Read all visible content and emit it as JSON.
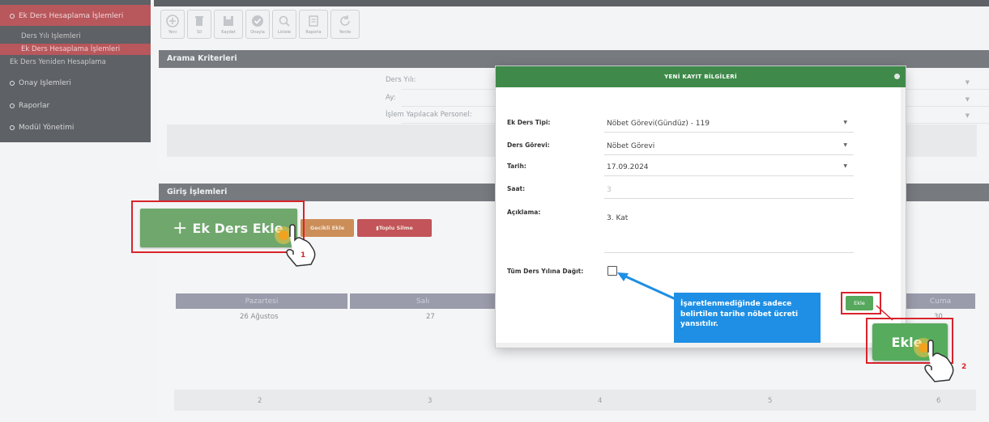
{
  "sidebar": {
    "active_section": "Ek Ders Hesaplama İşlemleri",
    "sub_items": [
      "Ders Yılı İşlemleri",
      "Ek Ders Hesaplama İşlemleri",
      "Ek Ders Yeniden Hesaplama"
    ],
    "sections": [
      "Onay İşlemleri",
      "Raporlar",
      "Modül Yönetimi"
    ]
  },
  "toolbar": {
    "buttons": [
      "Yeni",
      "Sil",
      "Kaydet",
      "Onayla",
      "Listele",
      "Raporla",
      "Yenile"
    ]
  },
  "search_panel": {
    "title": "Arama Kriterleri",
    "labels": [
      "Ders Yılı:",
      "Ay:",
      "İşlem Yapılacak Personel:"
    ]
  },
  "entry_panel": {
    "title": "Giriş İşlemleri",
    "add_button_label": "Ek Ders Ekle",
    "add_button_prefix": "+",
    "bulk_copy_label": "Gecikli Ekle",
    "bulk_delete_label": "Toplu Silme",
    "step1": "1"
  },
  "calendar": {
    "days": [
      "Pazartesi",
      "Salı",
      "Cuma"
    ],
    "dates": [
      "26 Ağustos",
      "27",
      "30"
    ],
    "week_numbers": [
      "2",
      "3",
      "4",
      "5",
      "6"
    ]
  },
  "modal": {
    "title": "YENİ KAYIT BİLGİLERİ",
    "fields": {
      "ek_ders_tipi": {
        "label": "Ek Ders Tipi:",
        "value": "Nöbet Görevi(Gündüz) - 119"
      },
      "ders_gorevi": {
        "label": "Ders Görevi:",
        "value": "Nöbet Görevi"
      },
      "tarih": {
        "label": "Tarih:",
        "value": "17.09.2024"
      },
      "saat": {
        "label": "Saat:",
        "value": "3"
      },
      "aciklama": {
        "label": "Açıklama:",
        "value": "3. Kat"
      },
      "tum_ders_yili": {
        "label": "Tüm Ders Yılına Dağıt:",
        "checked": false
      }
    },
    "submit_label": "Ekle"
  },
  "callout": {
    "text": "İşaretlenmediğinde sadece belirtilen tarihe nöbet ücreti yansıtılır."
  },
  "zoom": {
    "ekle_label": "Ekle",
    "step2": "2"
  },
  "colors": {
    "accent_green": "#57ab5d",
    "header_green": "#3f8a4a",
    "highlight_red": "#d9232b",
    "callout_blue": "#1e8fe4"
  }
}
